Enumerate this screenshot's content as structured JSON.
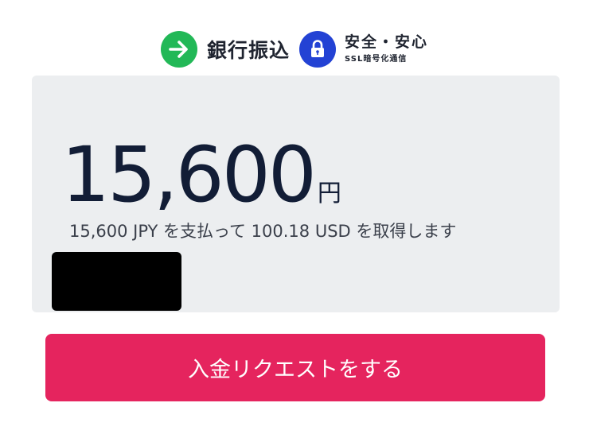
{
  "header": {
    "method_icon": "arrow-right-icon",
    "method_label": "銀行振込",
    "secure_icon": "lock-icon",
    "secure_title": "安全・安心",
    "secure_subtitle": "SSL暗号化通信"
  },
  "payment": {
    "amount": "15,600",
    "currency_unit": "円",
    "conversion_text": "15,600 JPY を支払って 100.18 USD を取得します"
  },
  "action": {
    "submit_label": "入金リクエストをする"
  },
  "colors": {
    "method_icon_bg": "#22b857",
    "secure_icon_bg": "#2342d4",
    "panel_bg": "#eceef0",
    "button_bg": "#e5245e",
    "amount_text": "#121d36"
  }
}
